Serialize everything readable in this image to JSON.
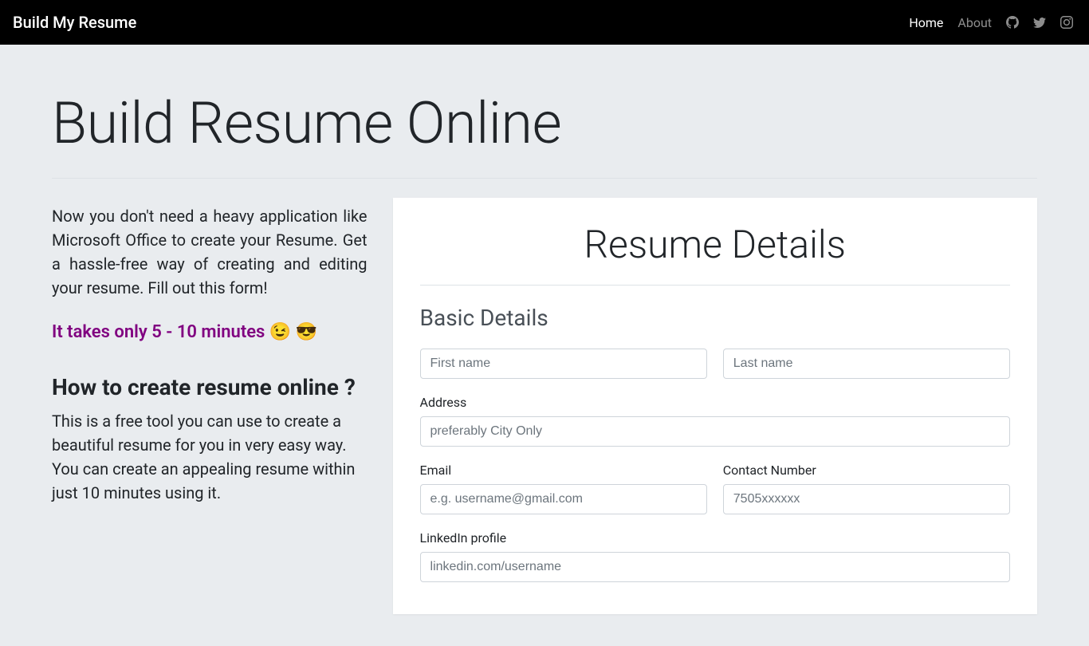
{
  "nav": {
    "brand": "Build My Resume",
    "links": [
      {
        "label": "Home",
        "active": true
      },
      {
        "label": "About",
        "active": false
      }
    ]
  },
  "page": {
    "title": "Build Resume Online",
    "intro": "Now you don't need a heavy application like Microsoft Office to create your Resume. Get a hassle-free way of creating and editing your resume. Fill out this form!",
    "minutes": "It takes only 5 - 10 minutes 😉 😎",
    "howto_title": "How to create resume online ?",
    "howto_body": "This is a free tool you can use to create a beautiful resume for you in very easy way. You can create an appealing resume within just 10 minutes using it."
  },
  "form": {
    "card_title": "Resume Details",
    "section": "Basic Details",
    "first_name": {
      "placeholder": "First name",
      "value": ""
    },
    "last_name": {
      "placeholder": "Last name",
      "value": ""
    },
    "address": {
      "label": "Address",
      "placeholder": "preferably City Only",
      "value": ""
    },
    "email": {
      "label": "Email",
      "placeholder": "e.g. username@gmail.com",
      "value": ""
    },
    "contact": {
      "label": "Contact Number",
      "placeholder": "7505xxxxxx",
      "value": ""
    },
    "linkedin": {
      "label": "LinkedIn profile",
      "placeholder": "linkedin.com/username",
      "value": ""
    }
  }
}
